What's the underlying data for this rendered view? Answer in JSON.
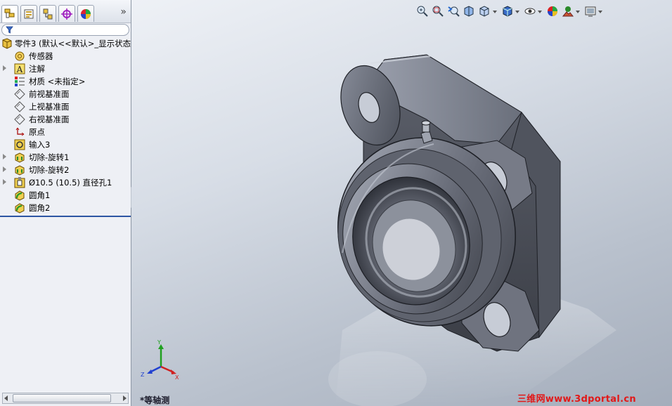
{
  "feature_manager": {
    "tabs": [
      {
        "name": "featuremanager-tab",
        "icon": "feature-tree-icon"
      },
      {
        "name": "propertymanager-tab",
        "icon": "property-manager-icon"
      },
      {
        "name": "configurationmanager-tab",
        "icon": "configuration-manager-icon"
      },
      {
        "name": "dimxpert-tab",
        "icon": "dimxpert-icon"
      },
      {
        "name": "display-manager-tab",
        "icon": "display-manager-icon"
      }
    ],
    "more_glyph": "»",
    "filter_placeholder": "",
    "tree": {
      "root": {
        "label": "零件3  (默认<<默认>_显示状态",
        "icon": "part-icon"
      },
      "items": [
        {
          "label": "传感器",
          "icon": "sensor-icon",
          "expandable": false
        },
        {
          "label": "注解",
          "icon": "annotation-icon",
          "expandable": true
        },
        {
          "label": "材质 <未指定>",
          "icon": "material-icon",
          "expandable": false
        },
        {
          "label": "前视基准面",
          "icon": "plane-icon",
          "expandable": false
        },
        {
          "label": "上视基准面",
          "icon": "plane-icon",
          "expandable": false
        },
        {
          "label": "右视基准面",
          "icon": "plane-icon",
          "expandable": false
        },
        {
          "label": "原点",
          "icon": "origin-icon",
          "expandable": false
        },
        {
          "label": "输入3",
          "icon": "imported-body-icon",
          "expandable": false
        },
        {
          "label": "切除-旋转1",
          "icon": "cut-revolve-icon",
          "expandable": true
        },
        {
          "label": "切除-旋转2",
          "icon": "cut-revolve-icon",
          "expandable": true
        },
        {
          "label": "Ø10.5 (10.5) 直径孔1",
          "icon": "hole-wizard-icon",
          "expandable": true
        },
        {
          "label": "圆角1",
          "icon": "fillet-icon",
          "expandable": false
        },
        {
          "label": "圆角2",
          "icon": "fillet-icon",
          "expandable": false
        }
      ]
    }
  },
  "heads_up_toolbar": [
    "zoom-to-fit-icon",
    "zoom-to-area-icon",
    "previous-view-icon",
    "section-view-icon",
    "view-orientation-icon",
    "display-style-icon",
    "hide-show-items-icon",
    "edit-appearance-icon",
    "apply-scene-icon",
    "view-settings-icon"
  ],
  "viewport": {
    "view_label": "*等轴测",
    "triad_axes": [
      "Y",
      "Z",
      "X"
    ],
    "watermark": "三维网www.3dportal.cn",
    "model": "flange-bearing-housing"
  },
  "colors": {
    "panel_bg": "#eef0f5",
    "tree_end_line": "#2d55a3",
    "model_steel": "#6e7280",
    "watermark_red": "#e21818",
    "axis_x": "#d02020",
    "axis_y": "#20a020",
    "axis_z": "#2040d0"
  }
}
